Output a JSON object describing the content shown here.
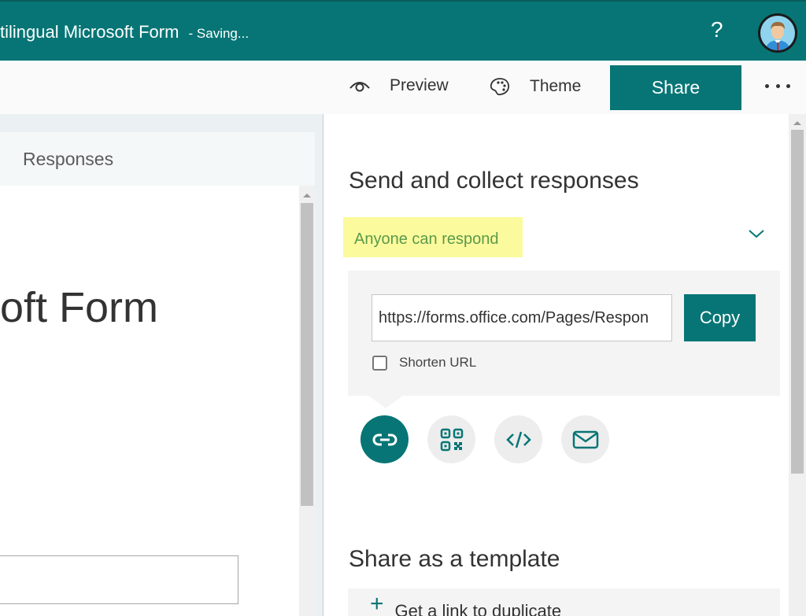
{
  "header": {
    "title": "tilingual Microsoft Form",
    "status": "- Saving...",
    "help_label": "?",
    "avatar_icon": "user-avatar"
  },
  "toolbar": {
    "preview_label": "Preview",
    "preview_icon": "eye-icon",
    "theme_label": "Theme",
    "theme_icon": "palette-icon",
    "share_label": "Share",
    "more_icon": "ellipsis-icon"
  },
  "left": {
    "tab_label": "Responses",
    "form_title": "oft Form",
    "input_value": ""
  },
  "share_panel": {
    "heading": "Send and collect responses",
    "permission": "Anyone can respond",
    "url_value": "https://forms.office.com/Pages/Respon",
    "copy_label": "Copy",
    "shorten_label": "Shorten URL",
    "shorten_checked": false,
    "options": [
      {
        "icon": "link-icon",
        "active": true
      },
      {
        "icon": "qr-code-icon",
        "active": false
      },
      {
        "icon": "embed-code-icon",
        "active": false
      },
      {
        "icon": "email-icon",
        "active": false
      }
    ],
    "template_heading": "Share as a template",
    "duplicate_label": "Get a link to duplicate"
  },
  "colors": {
    "brand": "#077575",
    "highlight": "#fbfa9c",
    "permission_text": "#5a9a4b"
  }
}
